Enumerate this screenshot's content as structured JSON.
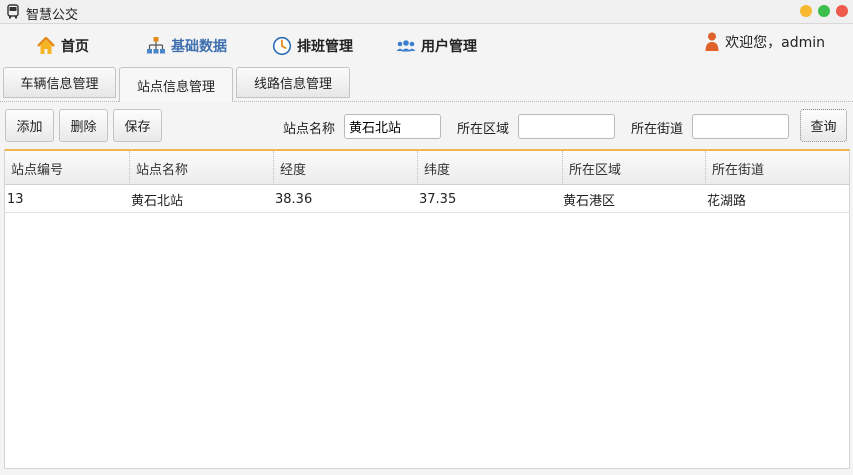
{
  "window": {
    "title": "智慧公交"
  },
  "menu": {
    "items": [
      {
        "label": "首页",
        "icon": "home-icon"
      },
      {
        "label": "基础数据",
        "icon": "sitemap-icon"
      },
      {
        "label": "排班管理",
        "icon": "clock-icon"
      },
      {
        "label": "用户管理",
        "icon": "users-icon"
      }
    ],
    "welcome": "欢迎您，admin"
  },
  "tabs": [
    {
      "label": "车辆信息管理"
    },
    {
      "label": "站点信息管理"
    },
    {
      "label": "线路信息管理"
    }
  ],
  "toolbar": {
    "add_label": "添加",
    "delete_label": "删除",
    "save_label": "保存",
    "station_name_label": "站点名称",
    "station_name_value": "黄石北站",
    "district_label": "所在区域",
    "district_value": "",
    "street_label": "所在街道",
    "street_value": "",
    "query_label": "查询"
  },
  "table": {
    "columns": [
      "站点编号",
      "站点名称",
      "经度",
      "纬度",
      "所在区域",
      "所在街道"
    ],
    "rows": [
      [
        "13",
        "黄石北站",
        "38.36",
        "37.35",
        "黄石港区",
        "花湖路"
      ]
    ]
  },
  "colors": {
    "accent": "#3f6fae",
    "table_top": "#f0b750",
    "win_min": "#f5b82e",
    "win_max": "#3bbf4a",
    "win_close": "#ee5b4d"
  }
}
